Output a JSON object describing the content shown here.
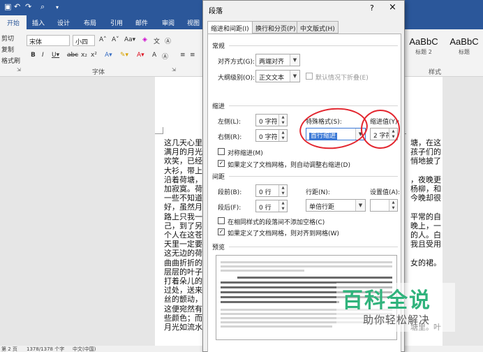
{
  "word": {
    "tabs": [
      "开始",
      "插入",
      "设计",
      "布局",
      "引用",
      "邮件",
      "审阅",
      "视图"
    ],
    "clipboard": {
      "cut": "剪切",
      "copy": "复制",
      "format_painter": "格式刷"
    },
    "font": {
      "name": "宋体",
      "size": "小四",
      "group_label": "字体"
    },
    "styles": [
      {
        "sample": "AaBbC",
        "name": "标题 2"
      },
      {
        "sample": "AaBbC",
        "name": "标题"
      }
    ],
    "styles_group_label": "样式",
    "status": {
      "page": "第 2 页",
      "words": "1378/1378 个字",
      "lang": "中文(中国)"
    },
    "doc_left": [
      "这几天心里",
      "满月的月光",
      "欢笑，已经",
      "大衫，带上",
      "沿着荷塘，",
      "加寂寞。荷",
      "一些不知道",
      "好，虽然月",
      "路上只我一",
      "己，到了另",
      "个人在这苍",
      "天里一定要",
      "这无边的荷",
      "曲曲折折的",
      "层层的叶子",
      "打着朵儿的",
      "过处，送来",
      "丝的颤动，",
      "这便宛然有",
      "些颜色；而",
      "月光如流水"
    ],
    "doc_right": [
      "塘，在这",
      "孩子们的",
      "悄地披了",
      "",
      "，夜晚更",
      "杨柳，和",
      "今晚却很",
      "",
      "平常的自",
      "晚上，一",
      "的人。白",
      "我且受用",
      "",
      "女的裙。",
      "",
      "",
      "",
      "",
      "",
      "",
      "塘里。叶"
    ]
  },
  "dialog": {
    "title": "段落",
    "help": "?",
    "close": "×",
    "tabs": [
      "缩进和间距(I)",
      "换行和分页(P)",
      "中文版式(H)"
    ],
    "general": {
      "heading": "常规",
      "alignment_label": "对齐方式(G):",
      "alignment_value": "两端对齐",
      "outline_label": "大纲级别(O):",
      "outline_value": "正文文本",
      "collapse_label": "默认情况下折叠(E)"
    },
    "indent": {
      "heading": "缩进",
      "left_label": "左侧(L):",
      "left_value": "0 字符",
      "right_label": "右侧(R):",
      "right_value": "0 字符",
      "special_label": "特殊格式(S):",
      "special_value": "首行缩进",
      "by_label": "缩进值(Y):",
      "by_value": "2 字符",
      "mirror_label": "对称缩进(M)",
      "grid_label": "如果定义了文档网格，则自动调整右缩进(D)"
    },
    "spacing": {
      "heading": "间距",
      "before_label": "段前(B):",
      "before_value": "0 行",
      "after_label": "段后(F):",
      "after_value": "0 行",
      "line_label": "行距(N):",
      "line_value": "单倍行距",
      "at_label": "设置值(A):",
      "at_value": "",
      "no_space_label": "在相同样式的段落间不添加空格(C)",
      "snap_grid_label": "如果定义了文档网格，则对齐到网格(W)"
    },
    "preview": {
      "heading": "预览"
    }
  },
  "watermark": {
    "title": "百科全说",
    "subtitle": "助你轻松解决"
  }
}
